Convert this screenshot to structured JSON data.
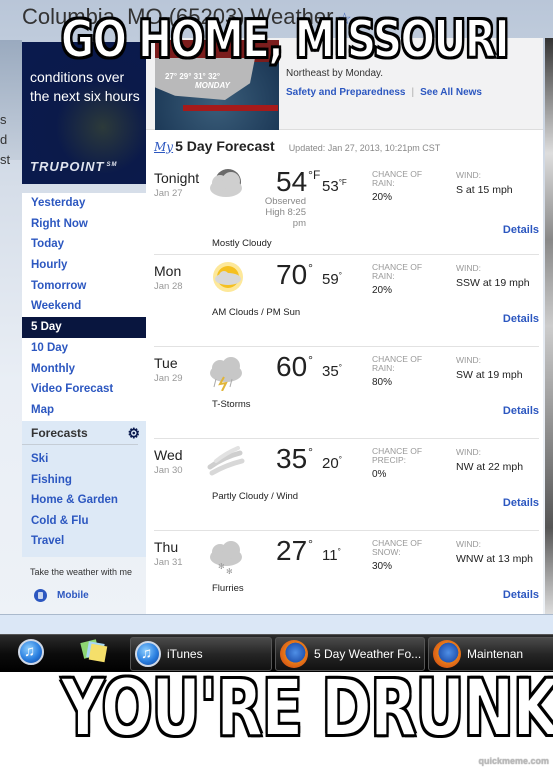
{
  "page": {
    "title": "Columbia, MO (65203) Weather",
    "left_fragment": [
      "s",
      "d",
      "st"
    ]
  },
  "promo": {
    "text": "conditions over the next six hours",
    "brand": "TRUPOINT",
    "brand_mark": "SM"
  },
  "nav": {
    "items": [
      {
        "label": "Yesterday",
        "active": false
      },
      {
        "label": "Right Now",
        "active": false
      },
      {
        "label": "Today",
        "active": false
      },
      {
        "label": "Hourly",
        "active": false
      },
      {
        "label": "Tomorrow",
        "active": false
      },
      {
        "label": "Weekend",
        "active": false
      },
      {
        "label": "5 Day",
        "active": true
      },
      {
        "label": "10 Day",
        "active": false
      },
      {
        "label": "Monthly",
        "active": false
      },
      {
        "label": "Video Forecast",
        "active": false
      },
      {
        "label": "Map",
        "active": false
      }
    ]
  },
  "forecasts": {
    "heading": "Forecasts",
    "items": [
      "Ski",
      "Fishing",
      "Home & Garden",
      "Cold & Flu",
      "Travel"
    ]
  },
  "mobile_promo": {
    "text": "Take the weather with me",
    "link": "Mobile"
  },
  "news": {
    "map_temps": "27° 29° 31° 32°",
    "map_label": "MONDAY",
    "body": "Northeast by Monday.",
    "links": [
      "Safety and Preparedness",
      "See All News"
    ],
    "separator": "|"
  },
  "forecast": {
    "my_label": "My",
    "title": "5 Day Forecast",
    "updated": "Updated: Jan 27, 2013, 10:21pm CST",
    "details_label": "Details",
    "wind_label": "WIND:",
    "days": [
      {
        "name": "Tonight",
        "date": "Jan 27",
        "icon": "mostly-cloudy-night-icon",
        "condition": "Mostly Cloudy",
        "high": "54",
        "high_unit": "°F",
        "low": "53",
        "low_unit": "°F",
        "observed": "Observed High 8:25 pm",
        "chance_label": "CHANCE OF RAIN:",
        "chance": "20%",
        "wind": "S at 15 mph"
      },
      {
        "name": "Mon",
        "date": "Jan 28",
        "icon": "am-clouds-pm-sun-icon",
        "condition": "AM Clouds / PM Sun",
        "high": "70",
        "high_unit": "°",
        "low": "59",
        "low_unit": "°",
        "chance_label": "CHANCE OF RAIN:",
        "chance": "20%",
        "wind": "SSW at 19 mph"
      },
      {
        "name": "Tue",
        "date": "Jan 29",
        "icon": "thunderstorm-icon",
        "condition": "T-Storms",
        "high": "60",
        "high_unit": "°",
        "low": "35",
        "low_unit": "°",
        "chance_label": "CHANCE OF RAIN:",
        "chance": "80%",
        "wind": "SW at 19 mph"
      },
      {
        "name": "Wed",
        "date": "Jan 30",
        "icon": "wind-icon",
        "condition": "Partly Cloudy / Wind",
        "high": "35",
        "high_unit": "°",
        "low": "20",
        "low_unit": "°",
        "chance_label": "CHANCE OF PRECIP:",
        "chance": "0%",
        "wind": "NW at 22 mph"
      },
      {
        "name": "Thu",
        "date": "Jan 31",
        "icon": "flurries-icon",
        "condition": "Flurries",
        "high": "27",
        "high_unit": "°",
        "low": "11",
        "low_unit": "°",
        "chance_label": "CHANCE OF SNOW:",
        "chance": "30%",
        "wind": "WNW at 13 mph"
      }
    ]
  },
  "taskbar": {
    "pinned": [
      "iTunes",
      "Sticky Notes"
    ],
    "buttons": [
      {
        "label": "iTunes",
        "icon": "itunes-icon"
      },
      {
        "label": "5 Day Weather Fo...",
        "icon": "firefox-icon"
      },
      {
        "label": "Maintenan",
        "icon": "firefox-icon"
      }
    ]
  },
  "meme": {
    "top": "GO HOME, MISSOURI",
    "bottom": "YOU'RE DRUNK",
    "watermark": "quickmeme.com"
  }
}
